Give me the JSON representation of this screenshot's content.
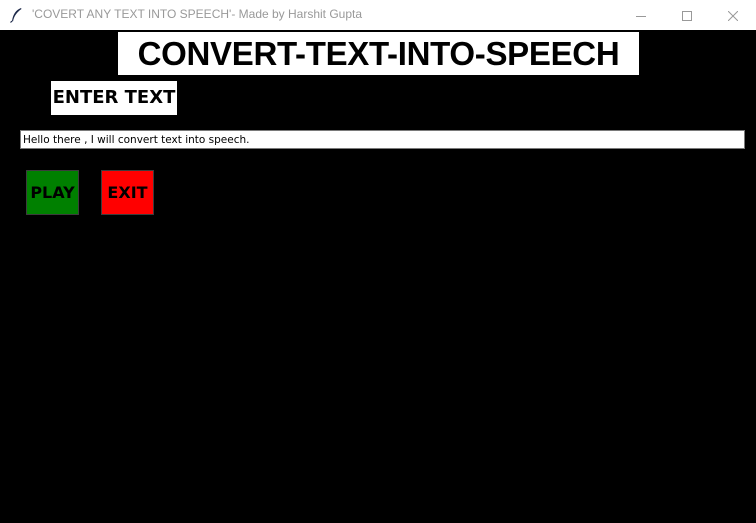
{
  "window": {
    "title": "'COVERT ANY TEXT INTO SPEECH'- Made by Harshit Gupta",
    "controls": {
      "minimize_icon": "minimize-icon",
      "maximize_icon": "maximize-icon",
      "close_icon": "close-icon"
    },
    "app_icon": "feather-icon"
  },
  "main": {
    "heading": "CONVERT-TEXT-INTO-SPEECH",
    "input_label": "ENTER TEXT",
    "text_input_value": "Hello there , I will convert text into speech.",
    "play_label": "PLAY",
    "exit_label": "EXIT"
  },
  "colors": {
    "background": "#000000",
    "play_button": "#008000",
    "exit_button": "#ff0000",
    "label_background": "#ffffff"
  }
}
